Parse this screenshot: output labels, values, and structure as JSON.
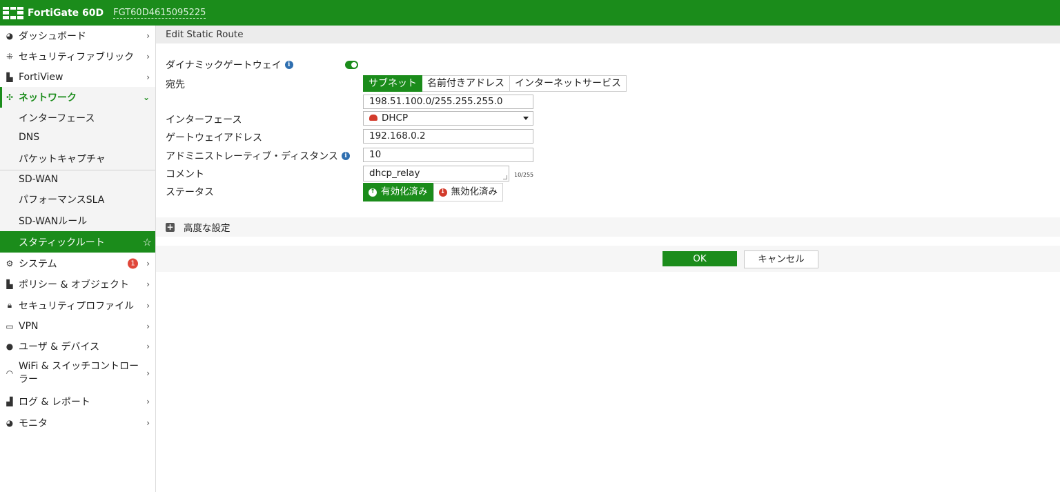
{
  "header": {
    "brand": "FortiGate 60D",
    "serial": "FGT60D4615095225",
    "color": "#1b8c1b"
  },
  "sidebar": {
    "items": [
      {
        "label": "ダッシュボード",
        "icon": "dashboard-icon"
      },
      {
        "label": "セキュリティファブリック",
        "icon": "fabric-icon"
      },
      {
        "label": "FortiView",
        "icon": "chart-icon"
      },
      {
        "label": "ネットワーク",
        "icon": "network-icon"
      },
      {
        "label": "インターフェース"
      },
      {
        "label": "DNS"
      },
      {
        "label": "パケットキャプチャ"
      },
      {
        "label": "SD-WAN"
      },
      {
        "label": "パフォーマンスSLA"
      },
      {
        "label": "SD-WANルール"
      },
      {
        "label": "スタティックルート"
      },
      {
        "label": "システム",
        "icon": "gear-icon",
        "badge": "1"
      },
      {
        "label": "ポリシー & オブジェクト",
        "icon": "policy-icon"
      },
      {
        "label": "セキュリティプロファイル",
        "icon": "lock-icon"
      },
      {
        "label": "VPN",
        "icon": "laptop-icon"
      },
      {
        "label": "ユーザ & デバイス",
        "icon": "user-icon"
      },
      {
        "label": "WiFi & スイッチコントロー",
        "label2": "ラー",
        "icon": "wifi-icon"
      },
      {
        "label": "ログ & レポート",
        "icon": "bar-chart-icon"
      },
      {
        "label": "モニタ",
        "icon": "pie-chart-icon"
      }
    ]
  },
  "page": {
    "title": "Edit Static Route"
  },
  "form": {
    "dynamic_gateway_label": "ダイナミックゲートウェイ",
    "dynamic_gateway_enabled": true,
    "destination_label": "宛先",
    "destination_tabs": [
      "サブネット",
      "名前付きアドレス",
      "インターネットサービス"
    ],
    "destination_value": "198.51.100.0/255.255.255.0",
    "interface_label": "インターフェース",
    "interface_value": "DHCP",
    "gateway_label": "ゲートウェイアドレス",
    "gateway_value": "192.168.0.2",
    "distance_label": "アドミニストレーティブ・ディスタンス",
    "distance_value": "10",
    "comment_label": "コメント",
    "comment_value": "dhcp_relay",
    "comment_counter": "10/255",
    "status_label": "ステータス",
    "status_enabled": "有効化済み",
    "status_disabled": "無効化済み",
    "advanced_label": "高度な設定"
  },
  "footer": {
    "ok_label": "OK",
    "cancel_label": "キャンセル"
  }
}
